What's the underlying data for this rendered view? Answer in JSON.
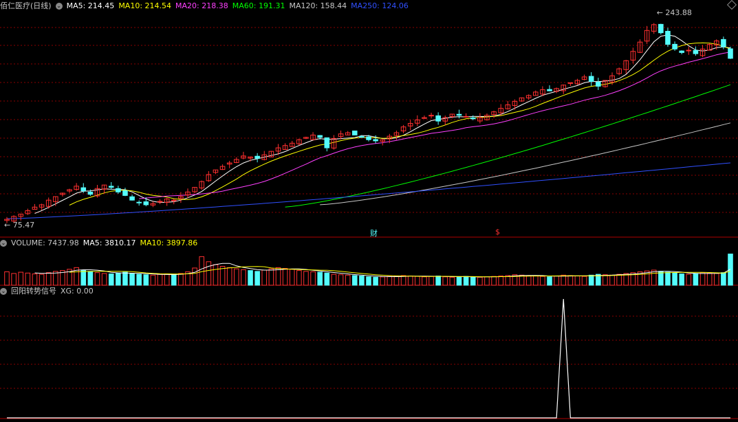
{
  "main_header": {
    "stock_name": "佰仁医疗(日线)",
    "ma": [
      {
        "label": "MA5: 214.45",
        "color": "#ffffff"
      },
      {
        "label": "MA10: 214.54",
        "color": "#ffff00"
      },
      {
        "label": "MA20: 218.38",
        "color": "#ff40ff"
      },
      {
        "label": "MA60: 191.31",
        "color": "#00ff00"
      },
      {
        "label": "MA120: 158.44",
        "color": "#c8c8c8"
      },
      {
        "label": "MA250: 124.06",
        "color": "#3050ff"
      }
    ]
  },
  "volume_header": {
    "title": "VOLUME: 7437.98",
    "ma5": "MA5: 3810.17",
    "ma10": "MA10: 3897.86"
  },
  "signal_header": {
    "title": "回阳转势信号",
    "xg": "XG: 0.00"
  },
  "markers": {
    "high_label": "243.88",
    "low_label": "75.47",
    "fin_label": "财",
    "dollar_label": "$"
  },
  "colors": {
    "up": "#ff3030",
    "down": "#54fcfc",
    "ma5": "#ffffff",
    "ma10": "#ffff00",
    "ma20": "#ff40ff",
    "ma60": "#00ff00",
    "ma120": "#c8c8c8",
    "ma250": "#3050ff",
    "grid": "#8b0000",
    "signal": "#ffffff"
  },
  "chart_data": [
    {
      "type": "candlestick",
      "title": "佰仁医疗(日线)",
      "price_range": [
        72,
        250
      ],
      "marked_high": 243.88,
      "marked_low": 75.47,
      "close": [
        75.5,
        78,
        80,
        83,
        86,
        88,
        92,
        95,
        98,
        101,
        104,
        100,
        97,
        102,
        105,
        103,
        99,
        96,
        92,
        90,
        88,
        89,
        91,
        93,
        92,
        95,
        99,
        103,
        108,
        114,
        118,
        121,
        124,
        127,
        130,
        129,
        128,
        131,
        134,
        137,
        139,
        141,
        144,
        146,
        148,
        146,
        137,
        145,
        149,
        150,
        148,
        146,
        144,
        143,
        144,
        147,
        150,
        155,
        158,
        161,
        163,
        165,
        160,
        163,
        166,
        165,
        164,
        162,
        163,
        165,
        168,
        171,
        174,
        177,
        180,
        182,
        185,
        187,
        186,
        188,
        191,
        193,
        195,
        198,
        194,
        190,
        195,
        199,
        205,
        212,
        220,
        228,
        238,
        243,
        236,
        226,
        222,
        219,
        221,
        218,
        222,
        226,
        229,
        224,
        214
      ],
      "ma_values": {
        "MA5": 214.45,
        "MA10": 214.54,
        "MA20": 218.38,
        "MA60": 191.31,
        "MA120": 158.44,
        "MA250": 124.06
      }
    },
    {
      "type": "bar",
      "title": "VOLUME",
      "last_value": 7437.98,
      "ma5": 3810.17,
      "ma10": 3897.86,
      "values": [
        3200,
        2800,
        3100,
        2900,
        2700,
        2600,
        3000,
        3300,
        3500,
        3800,
        4200,
        3600,
        3300,
        3000,
        2800,
        2700,
        2900,
        3100,
        2800,
        2600,
        2500,
        2400,
        2600,
        2700,
        2500,
        2800,
        3200,
        4100,
        6800,
        5600,
        4900,
        4500,
        4200,
        3900,
        3700,
        3500,
        3300,
        3600,
        3900,
        4200,
        4000,
        3800,
        3500,
        3300,
        3200,
        3100,
        2900,
        2600,
        2500,
        2400,
        2300,
        2200,
        2000,
        1900,
        2000,
        2100,
        2200,
        2300,
        2200,
        2100,
        2000,
        2100,
        2200,
        2000,
        1900,
        2000,
        2100,
        2000,
        1900,
        2000,
        2100,
        2200,
        2300,
        2500,
        2400,
        2300,
        2200,
        2100,
        2000,
        2200,
        2400,
        2300,
        2200,
        2100,
        2400,
        2600,
        2500,
        2400,
        2600,
        2800,
        3000,
        3200,
        3400,
        3600,
        3300,
        3100,
        2900,
        2700,
        2600,
        2800,
        3000,
        2900,
        2800,
        3000,
        7437.98
      ],
      "ylim": [
        0,
        9000
      ]
    },
    {
      "type": "line",
      "title": "回阳转势信号",
      "last_value": 0.0,
      "spike_index": 80,
      "ylim": [
        0,
        1
      ]
    }
  ]
}
